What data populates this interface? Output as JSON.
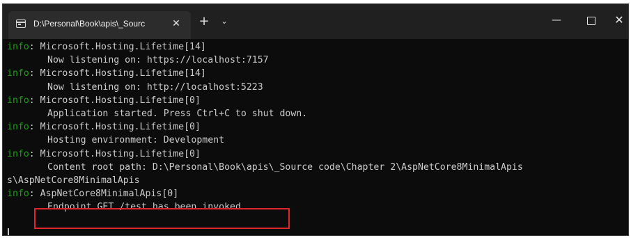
{
  "titlebar": {
    "tab_title": "D:\\Personal\\Book\\apis\\_Sourc",
    "tab_close_glyph": "✕",
    "new_tab_glyph": "+",
    "dropdown_glyph": "⌄",
    "minimize_glyph": "—",
    "close_glyph": "✕",
    "tab_icon": "terminal-icon"
  },
  "console": {
    "level_color": "#13a10e",
    "text_color": "#cccccc",
    "background": "#0c0c0c",
    "lines": [
      {
        "level": "info",
        "text": ": Microsoft.Hosting.Lifetime[14]"
      },
      {
        "text": "Now listening on: https://localhost:7157"
      },
      {
        "level": "info",
        "text": ": Microsoft.Hosting.Lifetime[14]"
      },
      {
        "text": "Now listening on: http://localhost:5223"
      },
      {
        "level": "info",
        "text": ": Microsoft.Hosting.Lifetime[0]"
      },
      {
        "text": "Application started. Press Ctrl+C to shut down."
      },
      {
        "level": "info",
        "text": ": Microsoft.Hosting.Lifetime[0]"
      },
      {
        "text": "Hosting environment: Development"
      },
      {
        "level": "info",
        "text": ": Microsoft.Hosting.Lifetime[0]"
      },
      {
        "text": "Content root path: D:\\Personal\\Book\\apis\\_Source code\\Chapter 2\\AspNetCore8MinimalApis"
      },
      {
        "text": "s\\AspNetCore8MinimalApis",
        "noindent": true
      },
      {
        "level": "info",
        "text": ": AspNetCore8MinimalApis[0]"
      },
      {
        "text": "Endpoint GET /test has been invoked"
      }
    ]
  },
  "annotation": {
    "highlight_color": "#e0262a"
  }
}
